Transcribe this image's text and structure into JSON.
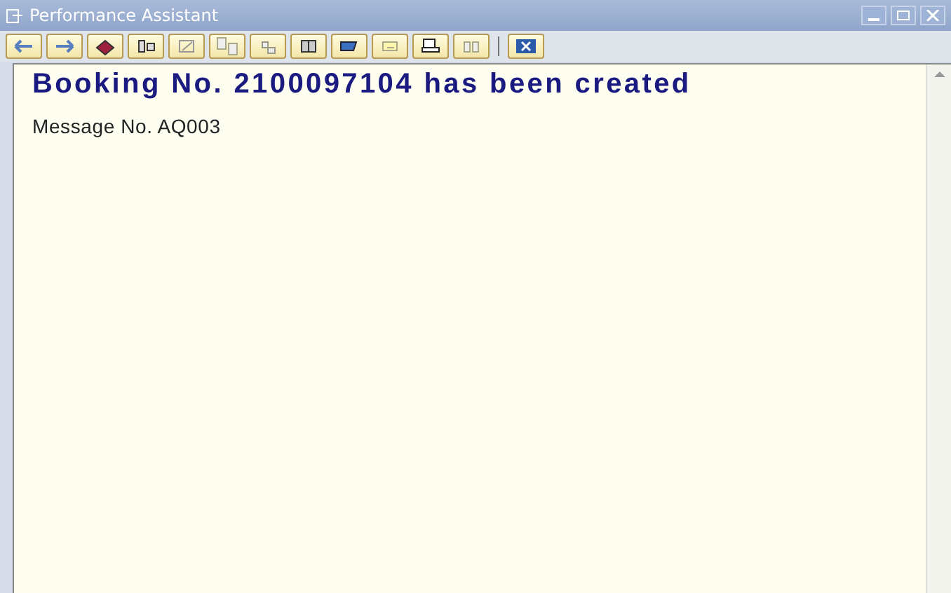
{
  "window": {
    "title": "Performance Assistant"
  },
  "message": {
    "heading": "Booking No. 2100097104 has been created",
    "detail": "Message No. AQ003"
  }
}
